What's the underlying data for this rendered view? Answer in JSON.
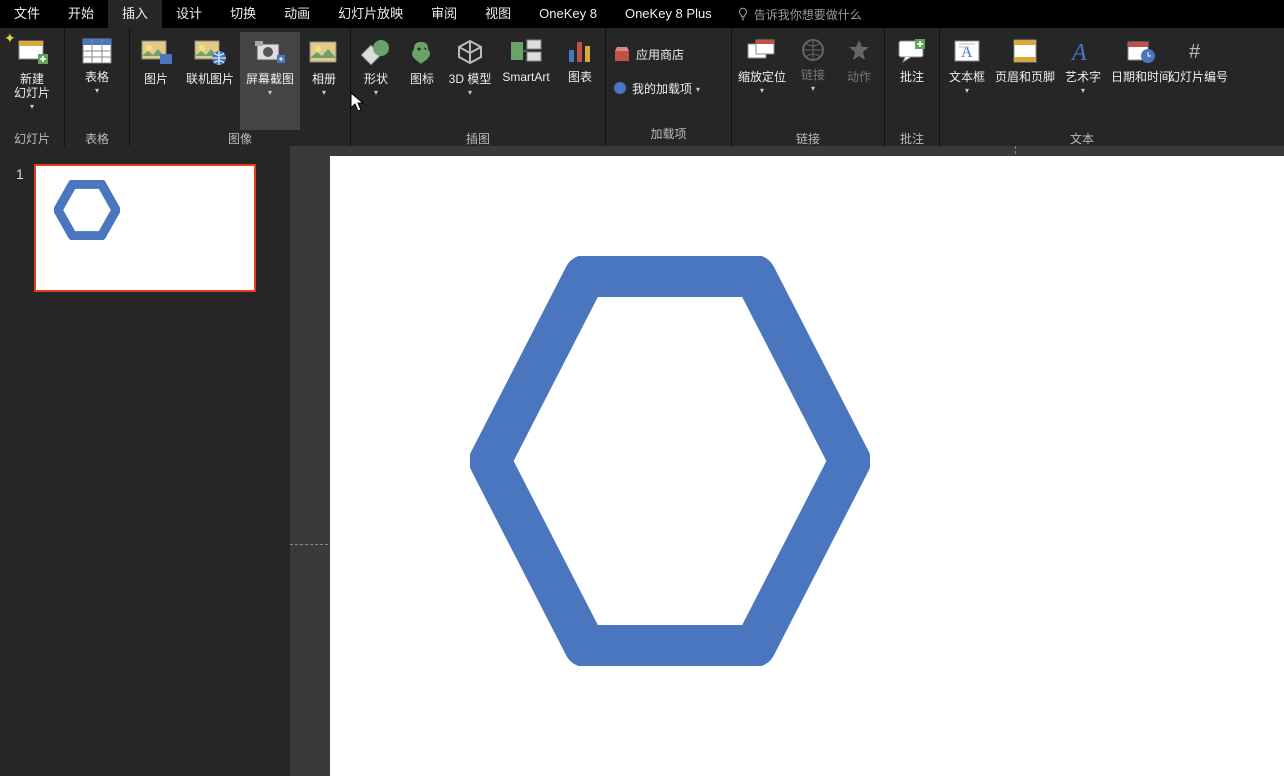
{
  "tabs": {
    "items": [
      {
        "label": "文件"
      },
      {
        "label": "开始"
      },
      {
        "label": "插入"
      },
      {
        "label": "设计"
      },
      {
        "label": "切换"
      },
      {
        "label": "动画"
      },
      {
        "label": "幻灯片放映"
      },
      {
        "label": "审阅"
      },
      {
        "label": "视图"
      },
      {
        "label": "OneKey 8"
      },
      {
        "label": "OneKey 8 Plus"
      }
    ],
    "active_index": 2,
    "tell_me": "告诉我你想要做什么"
  },
  "ribbon": {
    "groups": [
      {
        "label": "幻灯片",
        "buttons": [
          {
            "label": "新建\n幻灯片",
            "icon": "new-slide",
            "dd": true
          }
        ]
      },
      {
        "label": "表格",
        "buttons": [
          {
            "label": "表格",
            "icon": "table",
            "dd": true
          }
        ]
      },
      {
        "label": "图像",
        "buttons": [
          {
            "label": "图片",
            "icon": "pictures"
          },
          {
            "label": "联机图片",
            "icon": "online-pictures"
          },
          {
            "label": "屏幕截图",
            "icon": "screenshot",
            "dd": true,
            "hover": true
          },
          {
            "label": "相册",
            "icon": "photo-album",
            "dd": true
          }
        ]
      },
      {
        "label": "插图",
        "buttons": [
          {
            "label": "形状",
            "icon": "shapes",
            "dd": true
          },
          {
            "label": "图标",
            "icon": "icons"
          },
          {
            "label": "3D 模型",
            "icon": "3d-models",
            "dd": true
          },
          {
            "label": "SmartArt",
            "icon": "smartart"
          },
          {
            "label": "图表",
            "icon": "chart"
          }
        ]
      },
      {
        "label": "加载项",
        "small": [
          {
            "label": "应用商店",
            "icon": "store"
          },
          {
            "label": "我的加载项",
            "icon": "my-addins",
            "dd": true
          }
        ]
      },
      {
        "label": "链接",
        "buttons": [
          {
            "label": "缩放定位",
            "icon": "zoom",
            "dd": true
          },
          {
            "label": "链接",
            "icon": "link",
            "dd": true,
            "disabled": true
          },
          {
            "label": "动作",
            "icon": "action",
            "disabled": true
          }
        ]
      },
      {
        "label": "批注",
        "buttons": [
          {
            "label": "批注",
            "icon": "comment"
          }
        ]
      },
      {
        "label": "文本",
        "buttons": [
          {
            "label": "文本框",
            "icon": "text-box",
            "dd": true
          },
          {
            "label": "页眉和页脚",
            "icon": "header-footer"
          },
          {
            "label": "艺术字",
            "icon": "wordart",
            "dd": true
          },
          {
            "label": "日期和时间",
            "icon": "date-time"
          },
          {
            "label": "幻灯片编号",
            "icon": "slide-number"
          }
        ]
      }
    ]
  },
  "thumbnails": {
    "items": [
      {
        "number": "1"
      }
    ]
  },
  "shape": {
    "type": "hexagon",
    "stroke": "#4a76c0",
    "fill": "#ffffff"
  }
}
